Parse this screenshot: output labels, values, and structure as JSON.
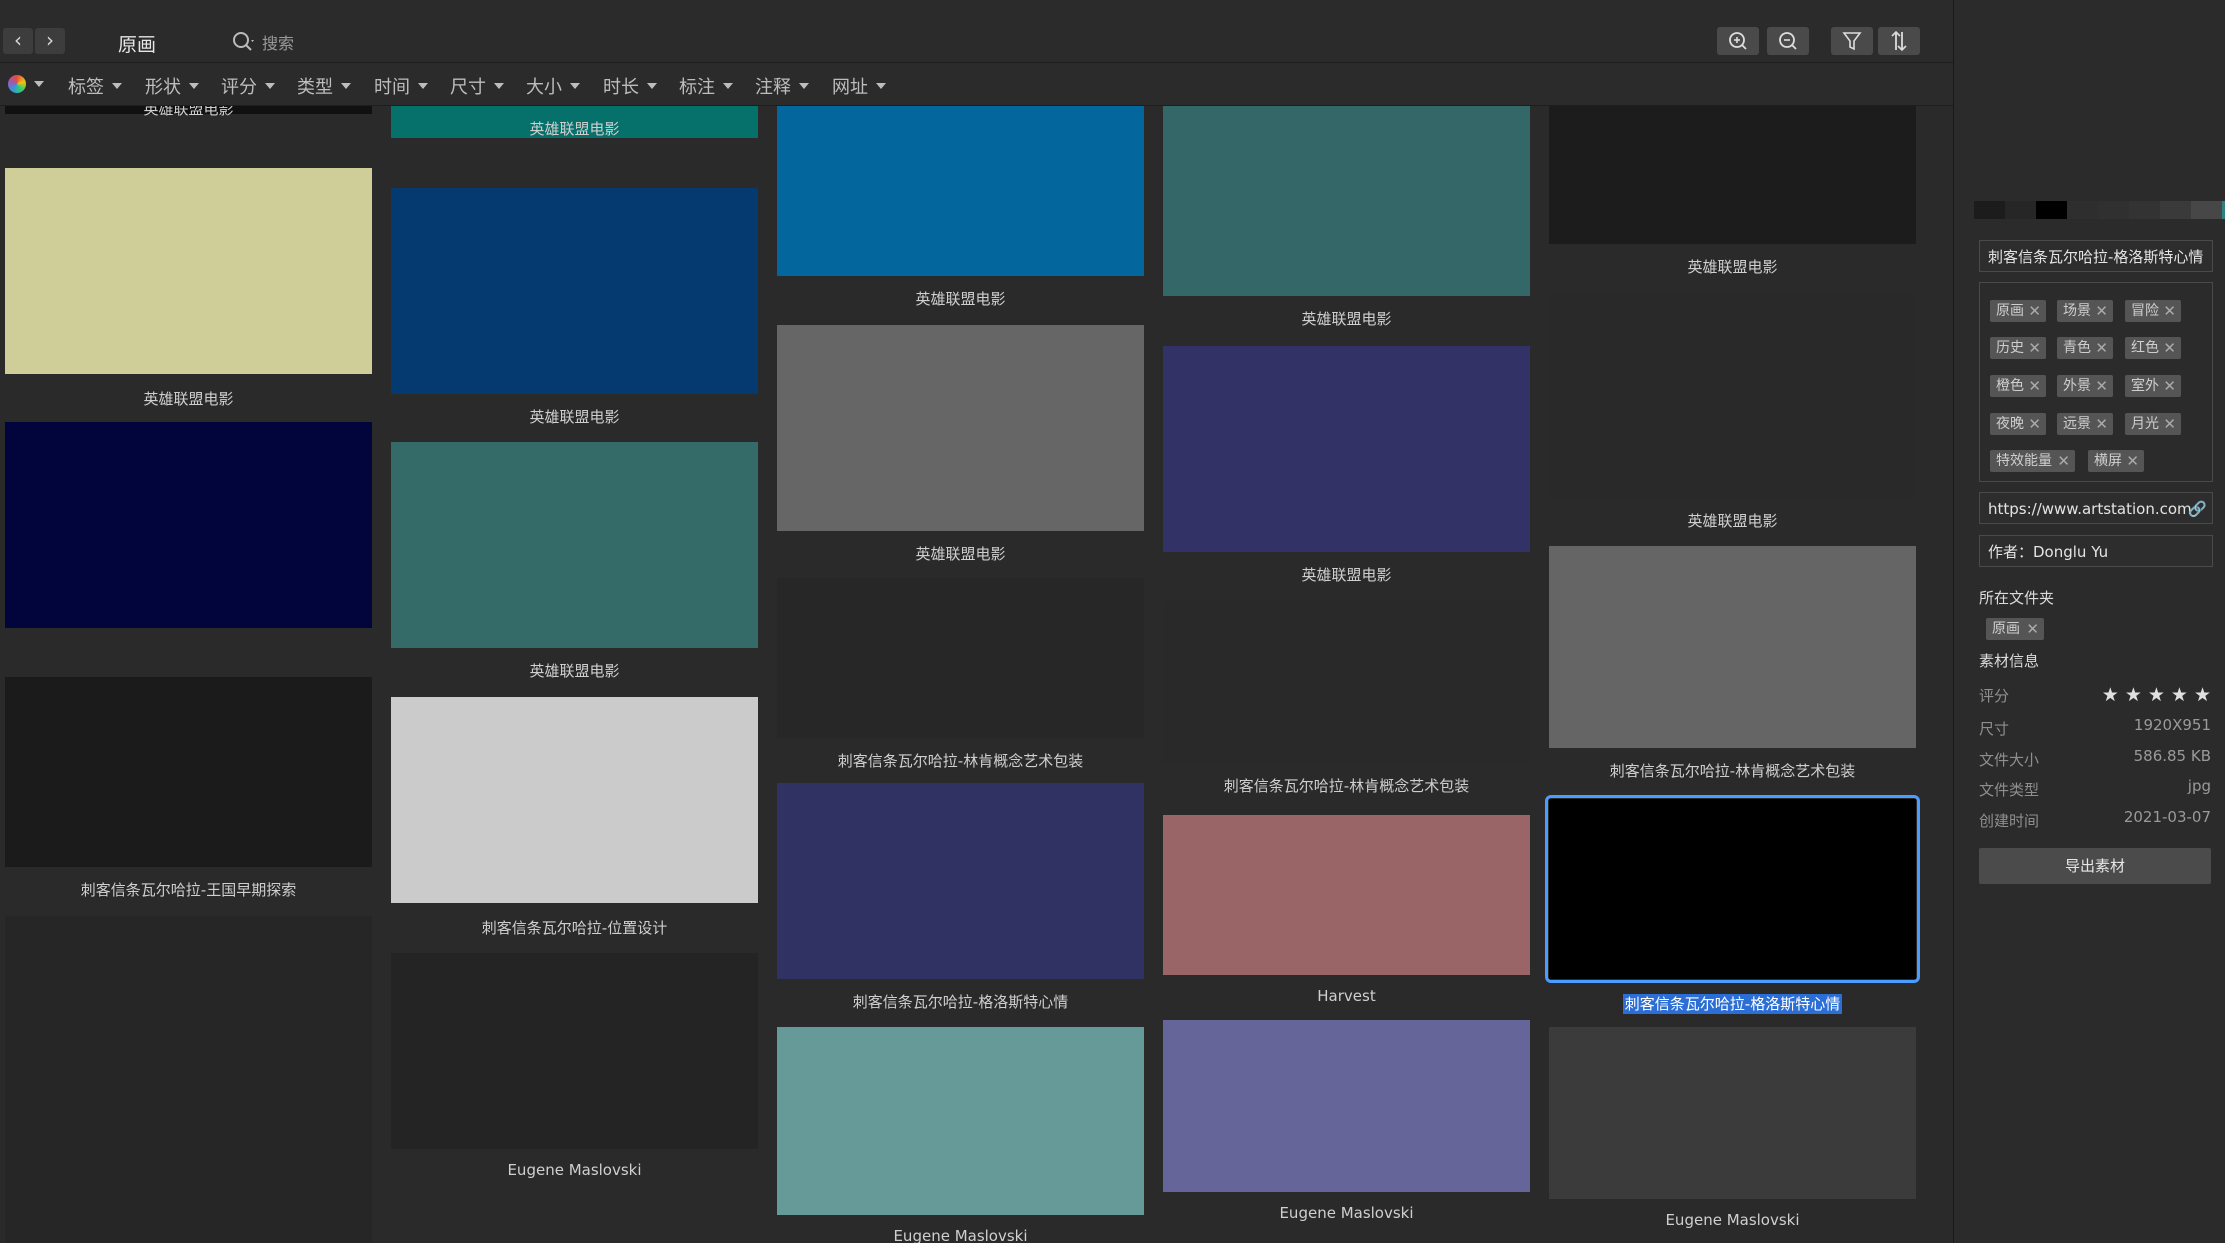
{
  "toolbar": {
    "title": "原画",
    "search_placeholder": "搜索",
    "back_icon": "‹",
    "forward_icon": "›"
  },
  "filters": [
    "标签",
    "形状",
    "评分",
    "类型",
    "时间",
    "尺寸",
    "大小",
    "时长",
    "标注",
    "注释",
    "网址"
  ],
  "cards": [
    {
      "label": "英雄联盟电影",
      "color": "#111111"
    },
    {
      "label": "英雄联盟电影",
      "color": "#cfcd98"
    },
    {
      "label": "",
      "color": "#02053b"
    },
    {
      "label": "刺客信条瓦尔哈拉-王国早期探索",
      "color": "#1b1b1b"
    },
    {
      "label": "",
      "color": "#262626"
    },
    {
      "label": "英雄联盟电影",
      "color": "#06706b"
    },
    {
      "label": "英雄联盟电影",
      "color": "#043a6f"
    },
    {
      "label": "英雄联盟电影",
      "color": "#346a68"
    },
    {
      "label": "刺客信条瓦尔哈拉-位置设计",
      "color": "#cbcbcb"
    },
    {
      "label": "Eugene Maslovski",
      "color": "#242424"
    },
    {
      "label": "英雄联盟电影",
      "color": "#03679e"
    },
    {
      "label": "英雄联盟电影",
      "color": "#666666"
    },
    {
      "label": "刺客信条瓦尔哈拉-林肯概念艺术包装",
      "color": "#272727"
    },
    {
      "label": "刺客信条瓦尔哈拉-格洛斯特心情",
      "color": "#313264"
    },
    {
      "label": "Eugene Maslovski",
      "color": "#669a99"
    },
    {
      "label": "英雄联盟电影",
      "color": "#346868"
    },
    {
      "label": "英雄联盟电影",
      "color": "#323266"
    },
    {
      "label": "刺客信条瓦尔哈拉-林肯概念艺术包装",
      "color": "#292929"
    },
    {
      "label": "Harvest",
      "color": "#9a6566"
    },
    {
      "label": "Eugene Maslovski",
      "color": "#656599"
    },
    {
      "label": "英雄联盟电影",
      "color": "#1c1c1c"
    },
    {
      "label": "英雄联盟电影",
      "color": "#292929"
    },
    {
      "label": "刺客信条瓦尔哈拉-林肯概念艺术包装",
      "color": "#656565"
    },
    {
      "label": "刺客信条瓦尔哈拉-格洛斯特心情",
      "color": "#000000",
      "selected": true
    },
    {
      "label": "Eugene Maslovski",
      "color": "#3b3b3b"
    }
  ],
  "panel": {
    "swatches": [
      "#1c1c1c",
      "#262626",
      "#000000",
      "#2e2e2e",
      "#303030",
      "#333333",
      "#3a3a3a",
      "#474747",
      "#2f7f7e"
    ],
    "name": "刺客信条瓦尔哈拉-格洛斯特心情",
    "tags": [
      "原画",
      "场景",
      "冒险",
      "历史",
      "青色",
      "红色",
      "橙色",
      "外景",
      "室外",
      "夜晚",
      "远景",
      "月光",
      "特效能量",
      "横屏"
    ],
    "url": "https://www.artstation.com",
    "author": "作者：Donglu Yu",
    "folder_title": "所在文件夹",
    "folder_tag": "原画",
    "info_title": "素材信息",
    "rating_label": "评分",
    "rating": 5,
    "size_label": "尺寸",
    "size_value": "1920X951",
    "filesize_label": "文件大小",
    "filesize_value": "586.85 KB",
    "filetype_label": "文件类型",
    "filetype_value": "jpg",
    "created_label": "创建时间",
    "created_value": "2021-03-07",
    "export_label": "导出素材"
  }
}
